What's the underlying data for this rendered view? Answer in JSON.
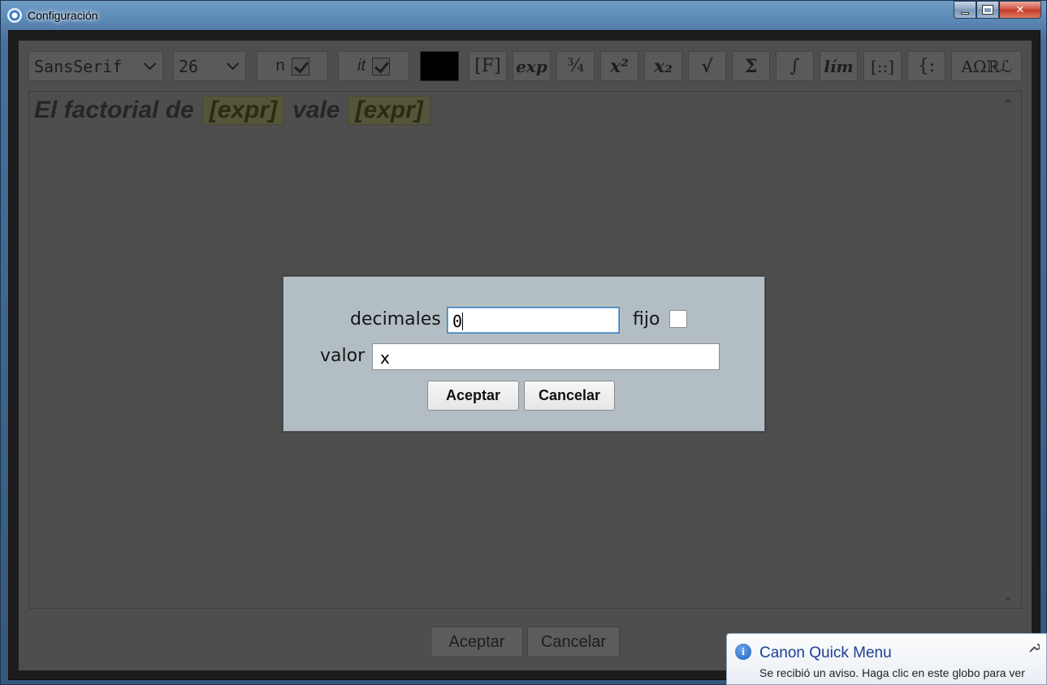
{
  "window": {
    "title": "Configuración",
    "minimize_glyph": "",
    "maximize_glyph": "",
    "close_glyph": "✕"
  },
  "toolbar": {
    "font_family": "SansSerif",
    "font_size": "26",
    "normal_label": "n",
    "normal_checked": true,
    "italic_label": "it",
    "italic_checked": true,
    "color": "#000000",
    "buttons": {
      "function": "[F]",
      "exp": "exp",
      "fraction": "¾",
      "superscript": "x²",
      "subscript": "x₂",
      "root": "√",
      "sum": "Σ",
      "integral": "∫",
      "limit": "lím",
      "matrix": "[::]",
      "brace": "{:",
      "symbols": "AΩℝℒ"
    }
  },
  "editor": {
    "text_1": "El factorial de",
    "placeholder_1": "[expr]",
    "text_2": "vale",
    "placeholder_2": "[expr]"
  },
  "footer": {
    "accept": "Aceptar",
    "cancel": "Cancelar"
  },
  "modal": {
    "decimals_label": "decimales",
    "decimals_value": "0",
    "fixed_label": "fijo",
    "fixed_checked": false,
    "value_label": "valor",
    "value_value": "x",
    "accept": "Aceptar",
    "cancel": "Cancelar"
  },
  "notification": {
    "title": "Canon Quick Menu",
    "text": "Se recibió un aviso. Haga clic en este globo para ver"
  }
}
